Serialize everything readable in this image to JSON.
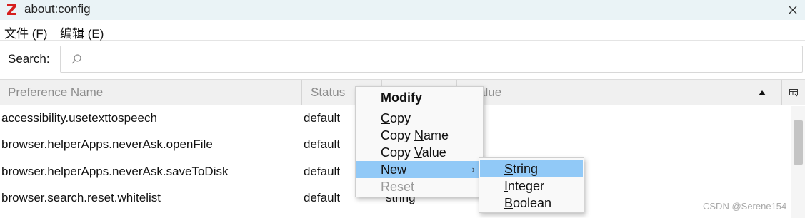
{
  "window": {
    "title": "about:config",
    "logo_letter": "Z"
  },
  "menubar": {
    "file": "文件 (F)",
    "edit": "编辑 (E)"
  },
  "search": {
    "label": "Search:",
    "value": "",
    "placeholder": ""
  },
  "columns": {
    "name": "Preference Name",
    "status": "Status",
    "type": "",
    "value": "Value"
  },
  "rows": [
    {
      "name": "accessibility.usetexttospeech",
      "status": "default",
      "type": ""
    },
    {
      "name": "browser.helperApps.neverAsk.openFile",
      "status": "default",
      "type": ""
    },
    {
      "name": "browser.helperApps.neverAsk.saveToDisk",
      "status": "default",
      "type": ""
    },
    {
      "name": "browser.search.reset.whitelist",
      "status": "default",
      "type": "string"
    }
  ],
  "context_menu": {
    "modify": "Modify",
    "copy": "Copy",
    "copy_name": "Copy Name",
    "copy_value": "Copy Value",
    "new": "New",
    "reset": "Reset"
  },
  "submenu_new": {
    "string": "String",
    "integer": "Integer",
    "boolean": "Boolean"
  },
  "watermark": "CSDN @Serene154",
  "colors": {
    "highlight": "#91c9f7",
    "titlebar": "#eaf3f6",
    "logo": "#d6201e"
  },
  "icons": [
    "app-logo",
    "close-icon",
    "search-icon",
    "sort-ascending-icon",
    "column-picker-icon",
    "submenu-arrow-icon"
  ]
}
